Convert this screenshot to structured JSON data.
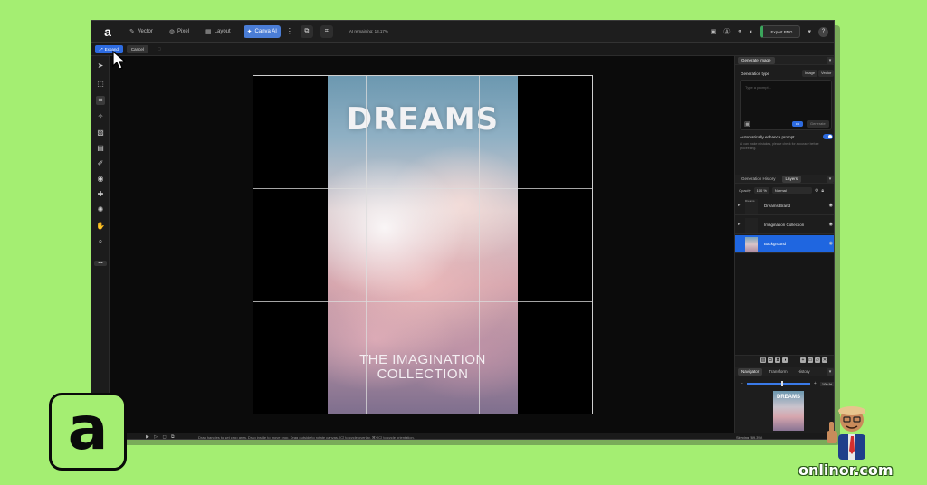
{
  "app": {
    "persona_tabs": [
      {
        "label": "Vector",
        "icon": "vector-icon"
      },
      {
        "label": "Pixel",
        "icon": "pixel-icon"
      },
      {
        "label": "Layout",
        "icon": "layout-icon"
      },
      {
        "label": "Canva AI",
        "icon": "sparkle-icon",
        "active": true
      }
    ],
    "ai_remaining": "AI remaining: 18.17%",
    "export_label": "Export PNG",
    "help_label": "?"
  },
  "subbar": {
    "expand_label": "Expand",
    "cancel_label": "Cancel"
  },
  "canvas": {
    "poster_title": "DREAMS",
    "poster_subtitle_line1": "THE IMAGINATION",
    "poster_subtitle_line2": "COLLECTION"
  },
  "right_panel": {
    "generate_tab": "Generate Image",
    "generation_type_label": "Generation type",
    "type_options": [
      "Image",
      "Vector"
    ],
    "prompt_placeholder": "Type a prompt...",
    "generate_button": "Generate",
    "enhance_label": "Automatically enhance prompt",
    "enhance_desc": "AI can make mistakes, please check for accuracy before proceeding.",
    "history_tab": "Generation History",
    "layers_tab": "Layers",
    "opacity_label": "Opacity",
    "opacity_value": "100 %",
    "blend_mode": "Normal",
    "layers": [
      {
        "name": "Dreams Brand",
        "thumb": "Dreams",
        "selected": false
      },
      {
        "name": "Imagination Collection",
        "thumb": "",
        "selected": false
      },
      {
        "name": "Background",
        "thumb": "",
        "selected": true
      }
    ],
    "navigator_tabs": [
      "Navigator",
      "Transform",
      "History"
    ],
    "zoom_value": "100 %",
    "nav_thumb_title": "DREAMS"
  },
  "status": {
    "page": "of 1",
    "hint": "Drag handles to set crop area. Drag inside to move crop. Drag outside to rotate canvas. [C] to cycle overlay. ⌘+[C] to cycle orientation.",
    "sky_status": "Skyping (89.3%)"
  },
  "brand": {
    "logo_letter": "a",
    "site": "onlinor.com"
  }
}
